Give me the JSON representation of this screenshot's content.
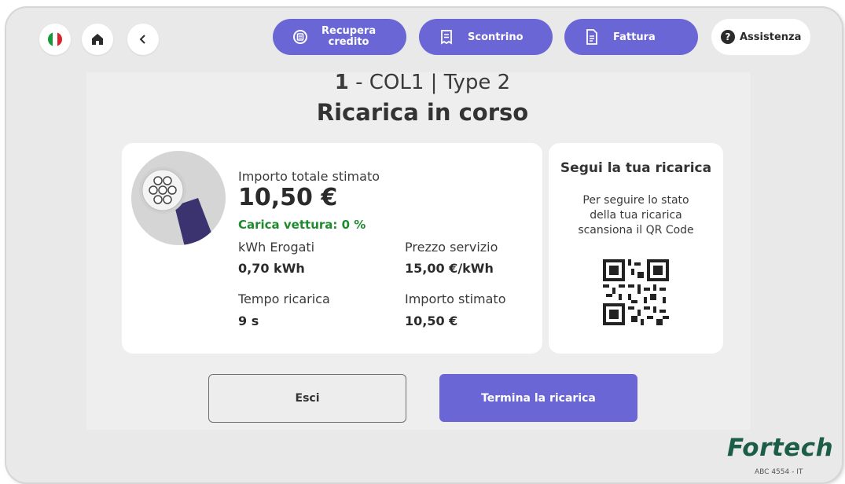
{
  "header": {
    "language_icon": "italy-flag-icon",
    "home_icon": "home-icon",
    "back_icon": "chevron-left-icon",
    "recupera_label_line1": "Recupera",
    "recupera_label_line2": "credito",
    "scontrino_label": "Scontrino",
    "fattura_label": "Fattura",
    "assistenza_label": "Assistenza"
  },
  "connector": {
    "number": "1",
    "separator": " - ",
    "name": "COL1 | Type 2"
  },
  "status_title": "Ricarica in corso",
  "charge": {
    "total_label": "Importo totale stimato",
    "total_value": "10,50 €",
    "vehicle_charge": "Carica vettura: 0 %",
    "kwh_label": "kWh Erogati",
    "kwh_value": "0,70 kWh",
    "price_label": "Prezzo servizio",
    "price_value": "15,00 €/kWh",
    "time_label": "Tempo ricarica",
    "time_value": "9 s",
    "estimated_label": "Importo stimato",
    "estimated_value": "10,50 €"
  },
  "follow": {
    "title": "Segui la tua ricarica",
    "description": "Per seguire lo stato della tua ricarica scansiona il QR Code"
  },
  "actions": {
    "exit_label": "Esci",
    "end_label": "Termina la ricarica"
  },
  "footer": {
    "brand": "Fortech",
    "serial": "ABC 4554 - IT"
  },
  "colors": {
    "accent": "#6b66d6",
    "success": "#1e8a2e",
    "brand": "#1b5d47"
  }
}
